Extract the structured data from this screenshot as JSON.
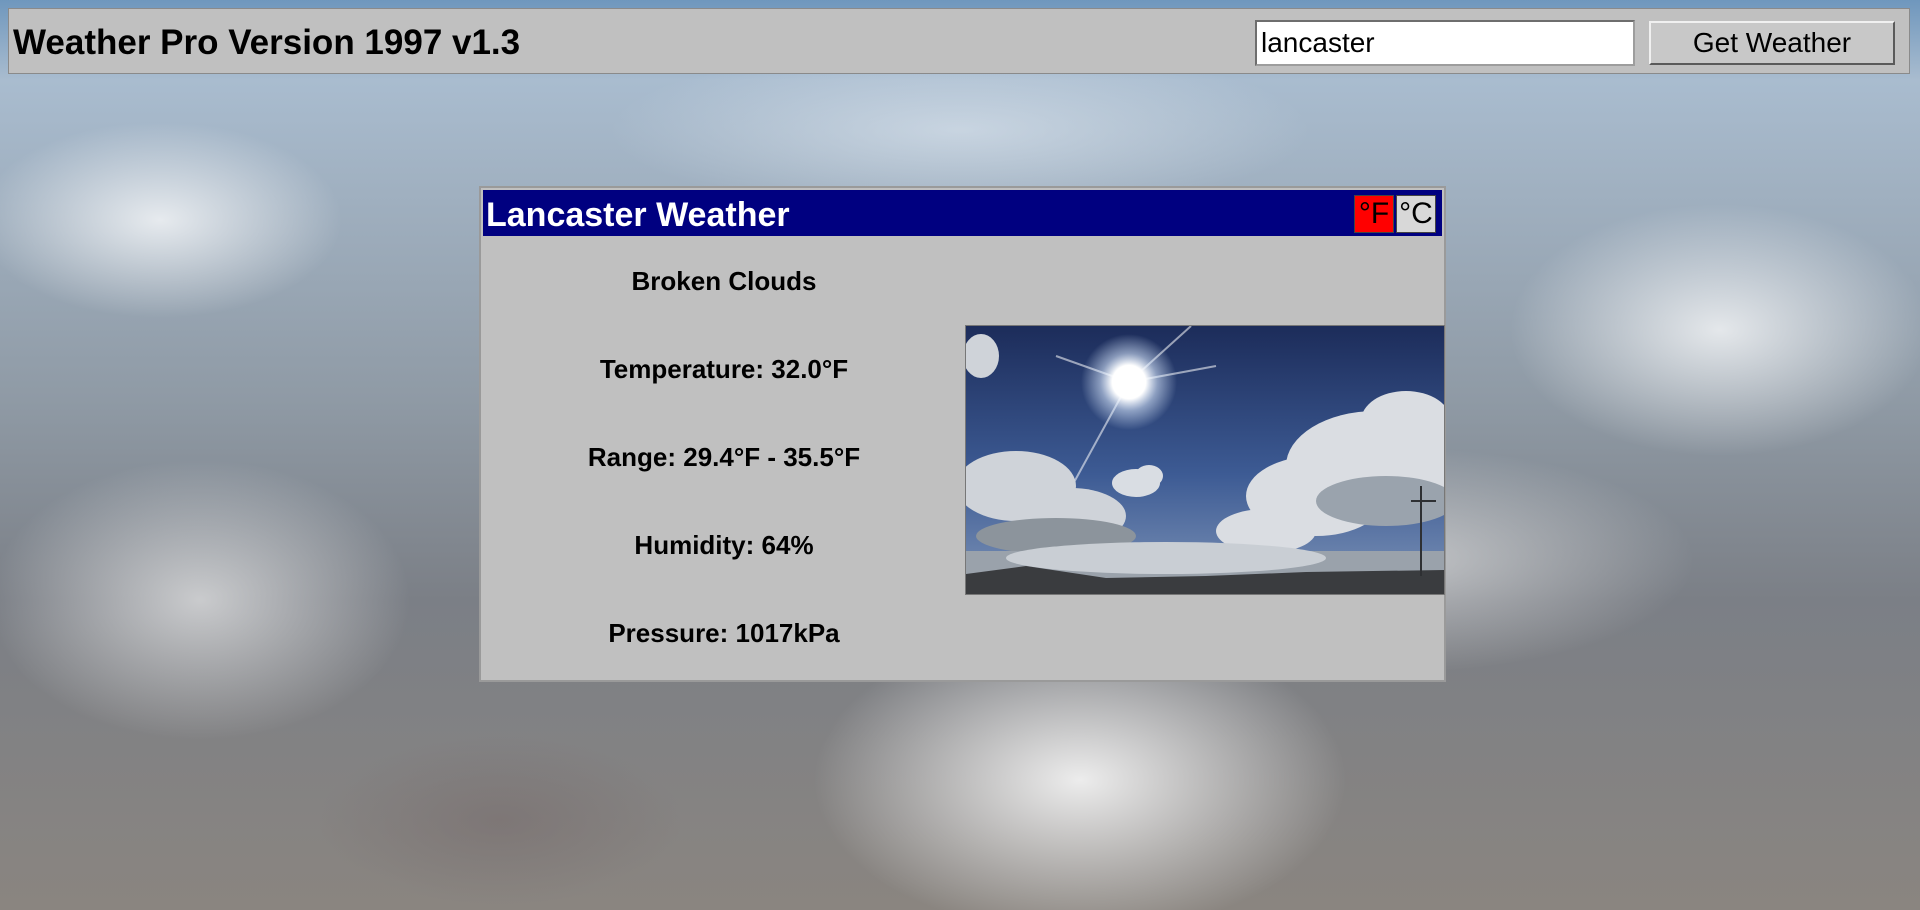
{
  "header": {
    "title": "Weather Pro Version 1997 v1.3",
    "search_value": "lancaster",
    "button_label": "Get Weather"
  },
  "weather": {
    "window_title": "Lancaster Weather",
    "unit_f": "°F",
    "unit_c": "°C",
    "selected_unit": "F",
    "selected_unit_color": "#ff0000",
    "titlebar_color": "#000080",
    "condition": "Broken Clouds",
    "temperature": "Temperature: 32.0°F",
    "range": "Range: 29.4°F - 35.5°F",
    "humidity": "Humidity: 64%",
    "pressure": "Pressure: 1017kPa",
    "image": "sky-with-sun-and-clouds"
  }
}
